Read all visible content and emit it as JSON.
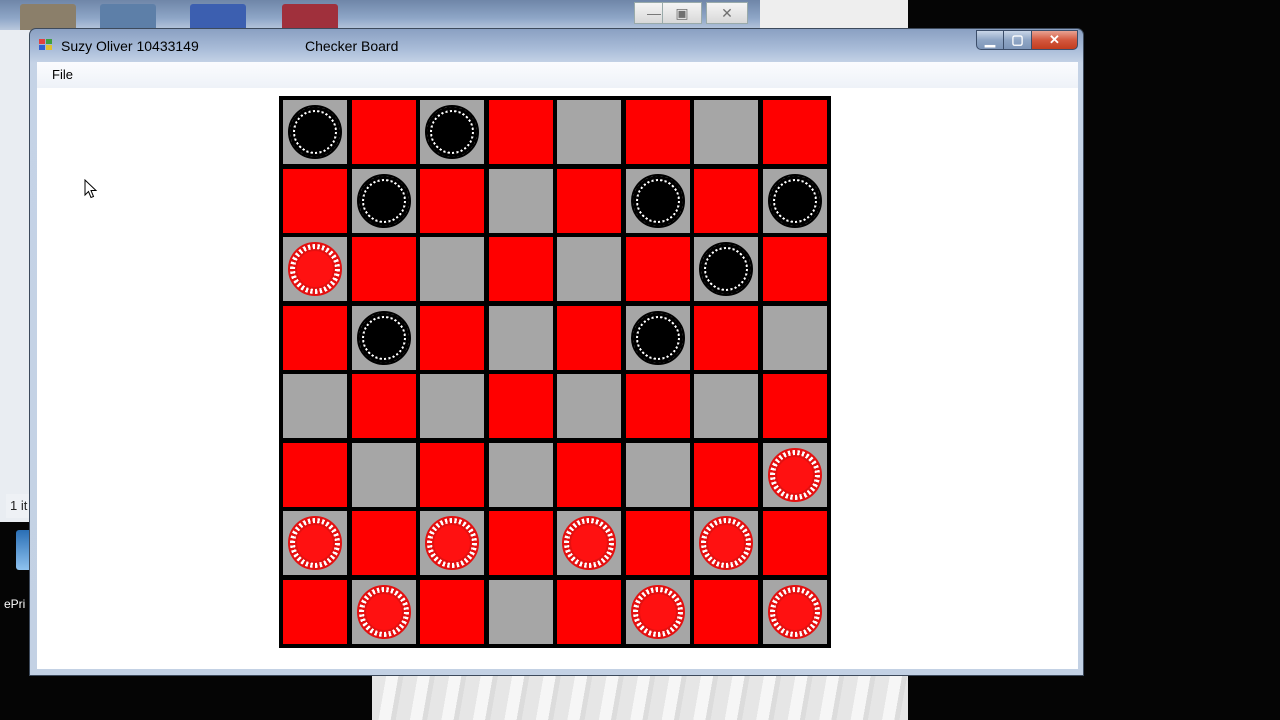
{
  "window": {
    "title_left": "Suzy Oliver 10433149",
    "title_center": "Checker Board",
    "minimize_glyph": "▁",
    "maximize_glyph": "▢",
    "close_glyph": "✕"
  },
  "menu": {
    "file_label": "File"
  },
  "background": {
    "status_text": "1 it",
    "desktop_label": "ePri",
    "back_window_minimize_glyph": "—",
    "back_window_maximize_glyph": "▣",
    "back_window_close_glyph": "✕"
  },
  "board": {
    "size": 8,
    "colors": {
      "red_square": "#ff0000",
      "gray_square": "#a6a6a6",
      "border": "#000000"
    },
    "squares": [
      [
        "gray",
        "red",
        "gray",
        "red",
        "gray",
        "red",
        "gray",
        "red"
      ],
      [
        "red",
        "gray",
        "red",
        "gray",
        "red",
        "gray",
        "red",
        "gray"
      ],
      [
        "gray",
        "red",
        "gray",
        "red",
        "gray",
        "red",
        "gray",
        "red"
      ],
      [
        "red",
        "gray",
        "red",
        "gray",
        "red",
        "gray",
        "red",
        "gray"
      ],
      [
        "gray",
        "red",
        "gray",
        "red",
        "gray",
        "red",
        "gray",
        "red"
      ],
      [
        "red",
        "gray",
        "red",
        "gray",
        "red",
        "gray",
        "red",
        "gray"
      ],
      [
        "gray",
        "red",
        "gray",
        "red",
        "gray",
        "red",
        "gray",
        "red"
      ],
      [
        "red",
        "gray",
        "red",
        "gray",
        "red",
        "gray",
        "red",
        "gray"
      ]
    ],
    "pieces": [
      [
        "black",
        "",
        "black",
        "",
        "",
        "",
        "",
        ""
      ],
      [
        "",
        "black",
        "",
        "",
        "",
        "black",
        "",
        "black"
      ],
      [
        "red",
        "",
        "",
        "",
        "",
        "",
        "black",
        ""
      ],
      [
        "",
        "black",
        "",
        "",
        "",
        "black",
        "",
        ""
      ],
      [
        "",
        "",
        "",
        "",
        "",
        "",
        "",
        ""
      ],
      [
        "",
        "",
        "",
        "",
        "",
        "",
        "",
        "red"
      ],
      [
        "red",
        "",
        "red",
        "",
        "red",
        "",
        "red",
        ""
      ],
      [
        "",
        "red",
        "",
        "",
        "",
        "red",
        "",
        "red"
      ]
    ]
  }
}
